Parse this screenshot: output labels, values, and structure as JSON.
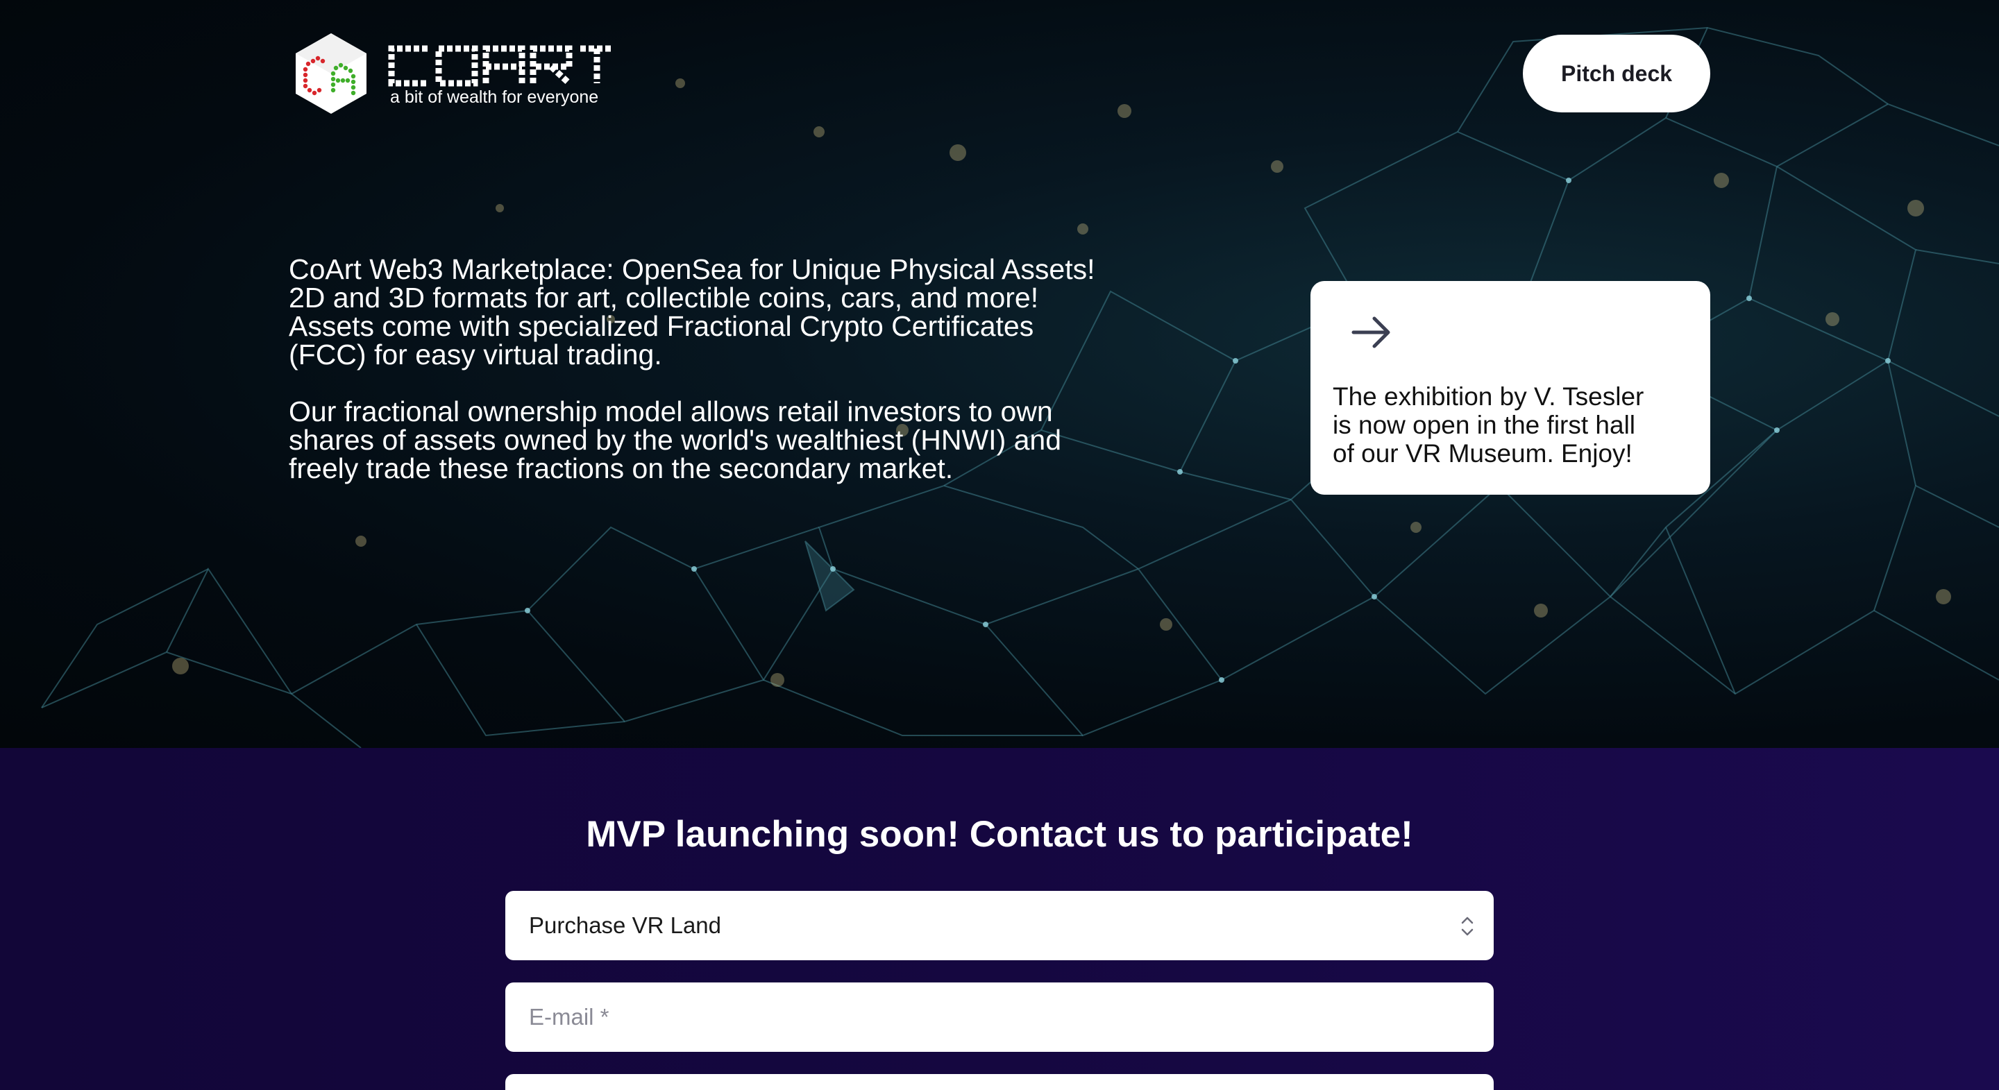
{
  "brand": {
    "wordmark": "COART",
    "tagline": "a bit of wealth for everyone",
    "colors": {
      "logo_red": "#d8262b",
      "logo_green": "#3fae2a"
    }
  },
  "header": {
    "pitch_deck_label": "Pitch deck"
  },
  "hero": {
    "paragraph_1": [
      "CoArt Web3 Marketplace: OpenSea for Unique Physical Assets!",
      "2D and 3D formats for art, collectible coins, cars, and more!",
      "Assets come with specialized Fractional Crypto Certificates",
      "(FCC) for easy virtual trading."
    ],
    "paragraph_2": [
      "Our fractional ownership model allows retail investors to own",
      "shares of assets owned by the world's wealthiest (HNWI) and",
      "freely trade these fractions on the secondary market."
    ]
  },
  "news_card": {
    "icon": "arrow-right-icon",
    "lines": [
      "The exhibition by V. Tsesler",
      "is now open in the first hall",
      "of our VR Museum. Enjoy!"
    ]
  },
  "contact": {
    "title": "MVP launching soon! Contact us to participate!",
    "select_value": "Purchase VR Land",
    "email_placeholder": "E-mail *",
    "colors": {
      "section_bg": "#150740"
    }
  }
}
